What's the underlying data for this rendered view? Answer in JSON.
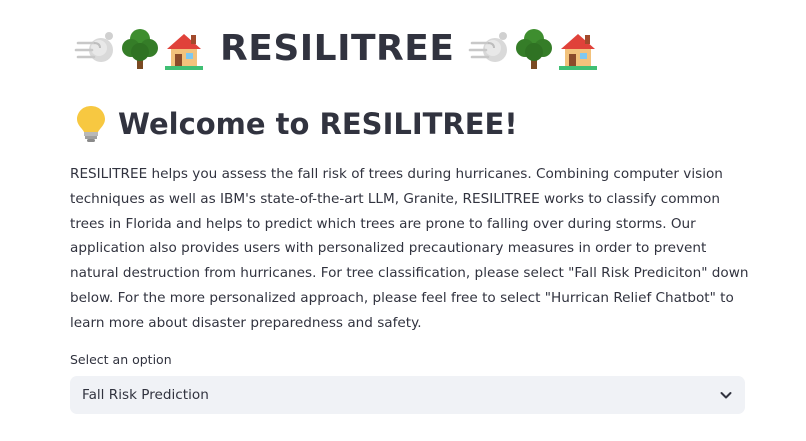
{
  "header": {
    "title": "RESILITREE",
    "left_icons": [
      "wind-icon",
      "tree-icon",
      "house-icon"
    ],
    "right_icons": [
      "wind-icon",
      "tree-icon",
      "house-icon"
    ]
  },
  "welcome": {
    "icon": "lightbulb-icon",
    "title": "Welcome to RESILITREE!"
  },
  "description": "RESILITREE helps you assess the fall risk of trees during hurricanes. Combining computer vision techniques as well as IBM's state-of-the-art LLM, Granite, RESILITREE works to classify common trees in Florida and helps to predict which trees are prone to falling over during storms. Our application also provides users with personalized precautionary measures in order to prevent natural destruction from hurricanes. For tree classification, please select \"Fall Risk Prediciton\" down below. For the more personalized approach, please feel free to select \"Hurrican Relief Chatbot\" to learn more about disaster preparedness and safety.",
  "selector": {
    "label": "Select an option",
    "selected": "Fall Risk Prediction"
  },
  "colors": {
    "text": "#31333f",
    "select_bg": "#f0f2f6",
    "tree_green": "#3e8e2f",
    "roof_red": "#e0423a"
  }
}
